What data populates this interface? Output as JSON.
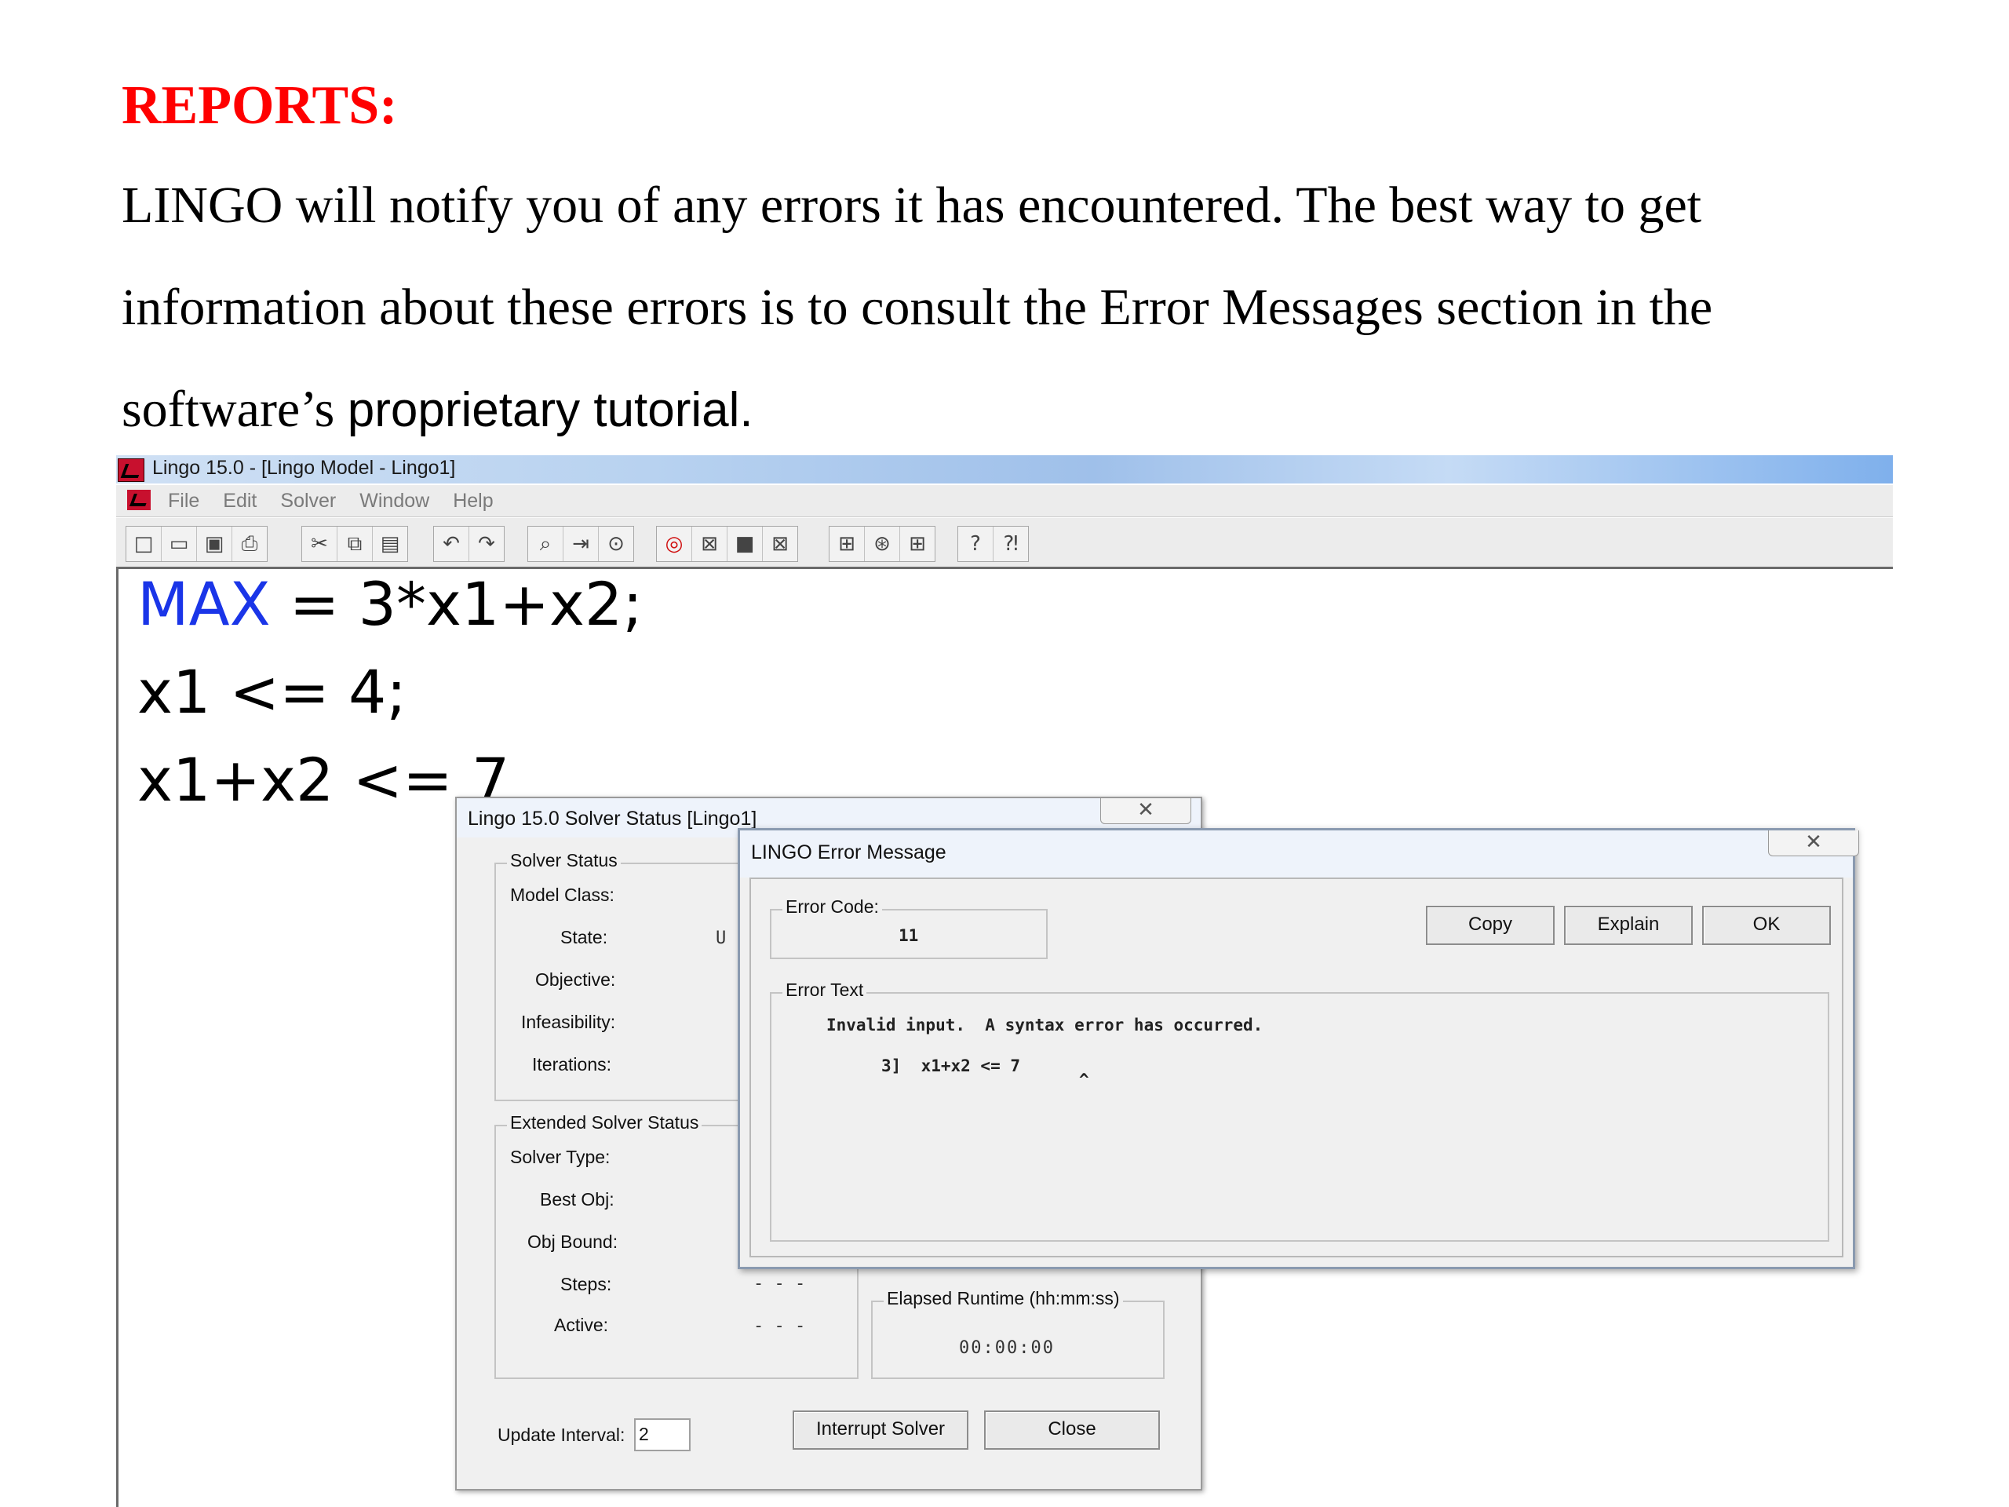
{
  "document": {
    "heading": "REPORTS:",
    "paragraph_lines": [
      "LINGO will notify you of any errors it has encountered. The best way to get",
      "information about these errors is to consult the Error Messages section in the",
      "software’s"
    ],
    "paragraph_tail": "proprietary tutorial."
  },
  "app": {
    "title": "Lingo 15.0 - [Lingo Model - Lingo1]",
    "menu": [
      "File",
      "Edit",
      "Solver",
      "Window",
      "Help"
    ],
    "toolbar_groups": [
      [
        "new-icon",
        "open-icon",
        "save-icon",
        "print-icon"
      ],
      [
        "cut-icon",
        "copy-icon",
        "paste-icon"
      ],
      [
        "undo-icon",
        "redo-icon"
      ],
      [
        "find-icon",
        "goto-icon",
        "match-paren-icon"
      ],
      [
        "solve-icon",
        "solution-icon",
        "stop-icon",
        "close-all-icon"
      ],
      [
        "tile-icon",
        "options-icon",
        "window-icon"
      ],
      [
        "help-icon",
        "context-help-icon"
      ]
    ],
    "toolbar_glyphs": [
      [
        "□",
        "▭",
        "▣",
        "⎙"
      ],
      [
        "✂",
        "⧉",
        "▤"
      ],
      [
        "↶",
        "↷"
      ],
      [
        "⌕",
        "⇥",
        "⊙"
      ],
      [
        "◎",
        "⊠",
        "■",
        "⊠"
      ],
      [
        "⊞",
        "⊛",
        "⊞"
      ],
      [
        "?",
        "⁈"
      ]
    ]
  },
  "editor": {
    "line1_keyword": "MAX",
    "line1_rest": " = 3*x1+x2;",
    "line2": "x1 <= 4;",
    "line3": "x1+x2 <= 7"
  },
  "solver_status": {
    "title": "Lingo 15.0 Solver Status [Lingo1]",
    "close_glyph": "✕",
    "solver_status_group": "Solver Status",
    "model_class_label": "Model Class:",
    "state_label": "State:",
    "state_value": "U",
    "objective_label": "Objective:",
    "infeasibility_label": "Infeasibility:",
    "iterations_label": "Iterations:",
    "extended_group": "Extended Solver Status",
    "solver_type_label": "Solver Type:",
    "best_obj_label": "Best Obj:",
    "obj_bound_label": "Obj Bound:",
    "steps_label": "Steps:",
    "steps_value": "- - -",
    "active_label": "Active:",
    "active_value": "- - -",
    "elapsed_group": "Elapsed Runtime (hh:mm:ss)",
    "elapsed_value": "00:00:00",
    "update_interval_label": "Update Interval:",
    "update_interval_value": "2",
    "interrupt_button": "Interrupt Solver",
    "close_button": "Close"
  },
  "error_message": {
    "title": "LINGO Error Message",
    "close_glyph": "✕",
    "error_code_label": "Error Code:",
    "error_code_value": "11",
    "copy_button": "Copy",
    "explain_button": "Explain",
    "ok_button": "OK",
    "error_text_label": "Error Text",
    "error_text_line1": "Invalid input.  A syntax error has occurred.",
    "error_text_line2": "3]  x1+x2 <= 7",
    "error_text_caret": "^"
  }
}
